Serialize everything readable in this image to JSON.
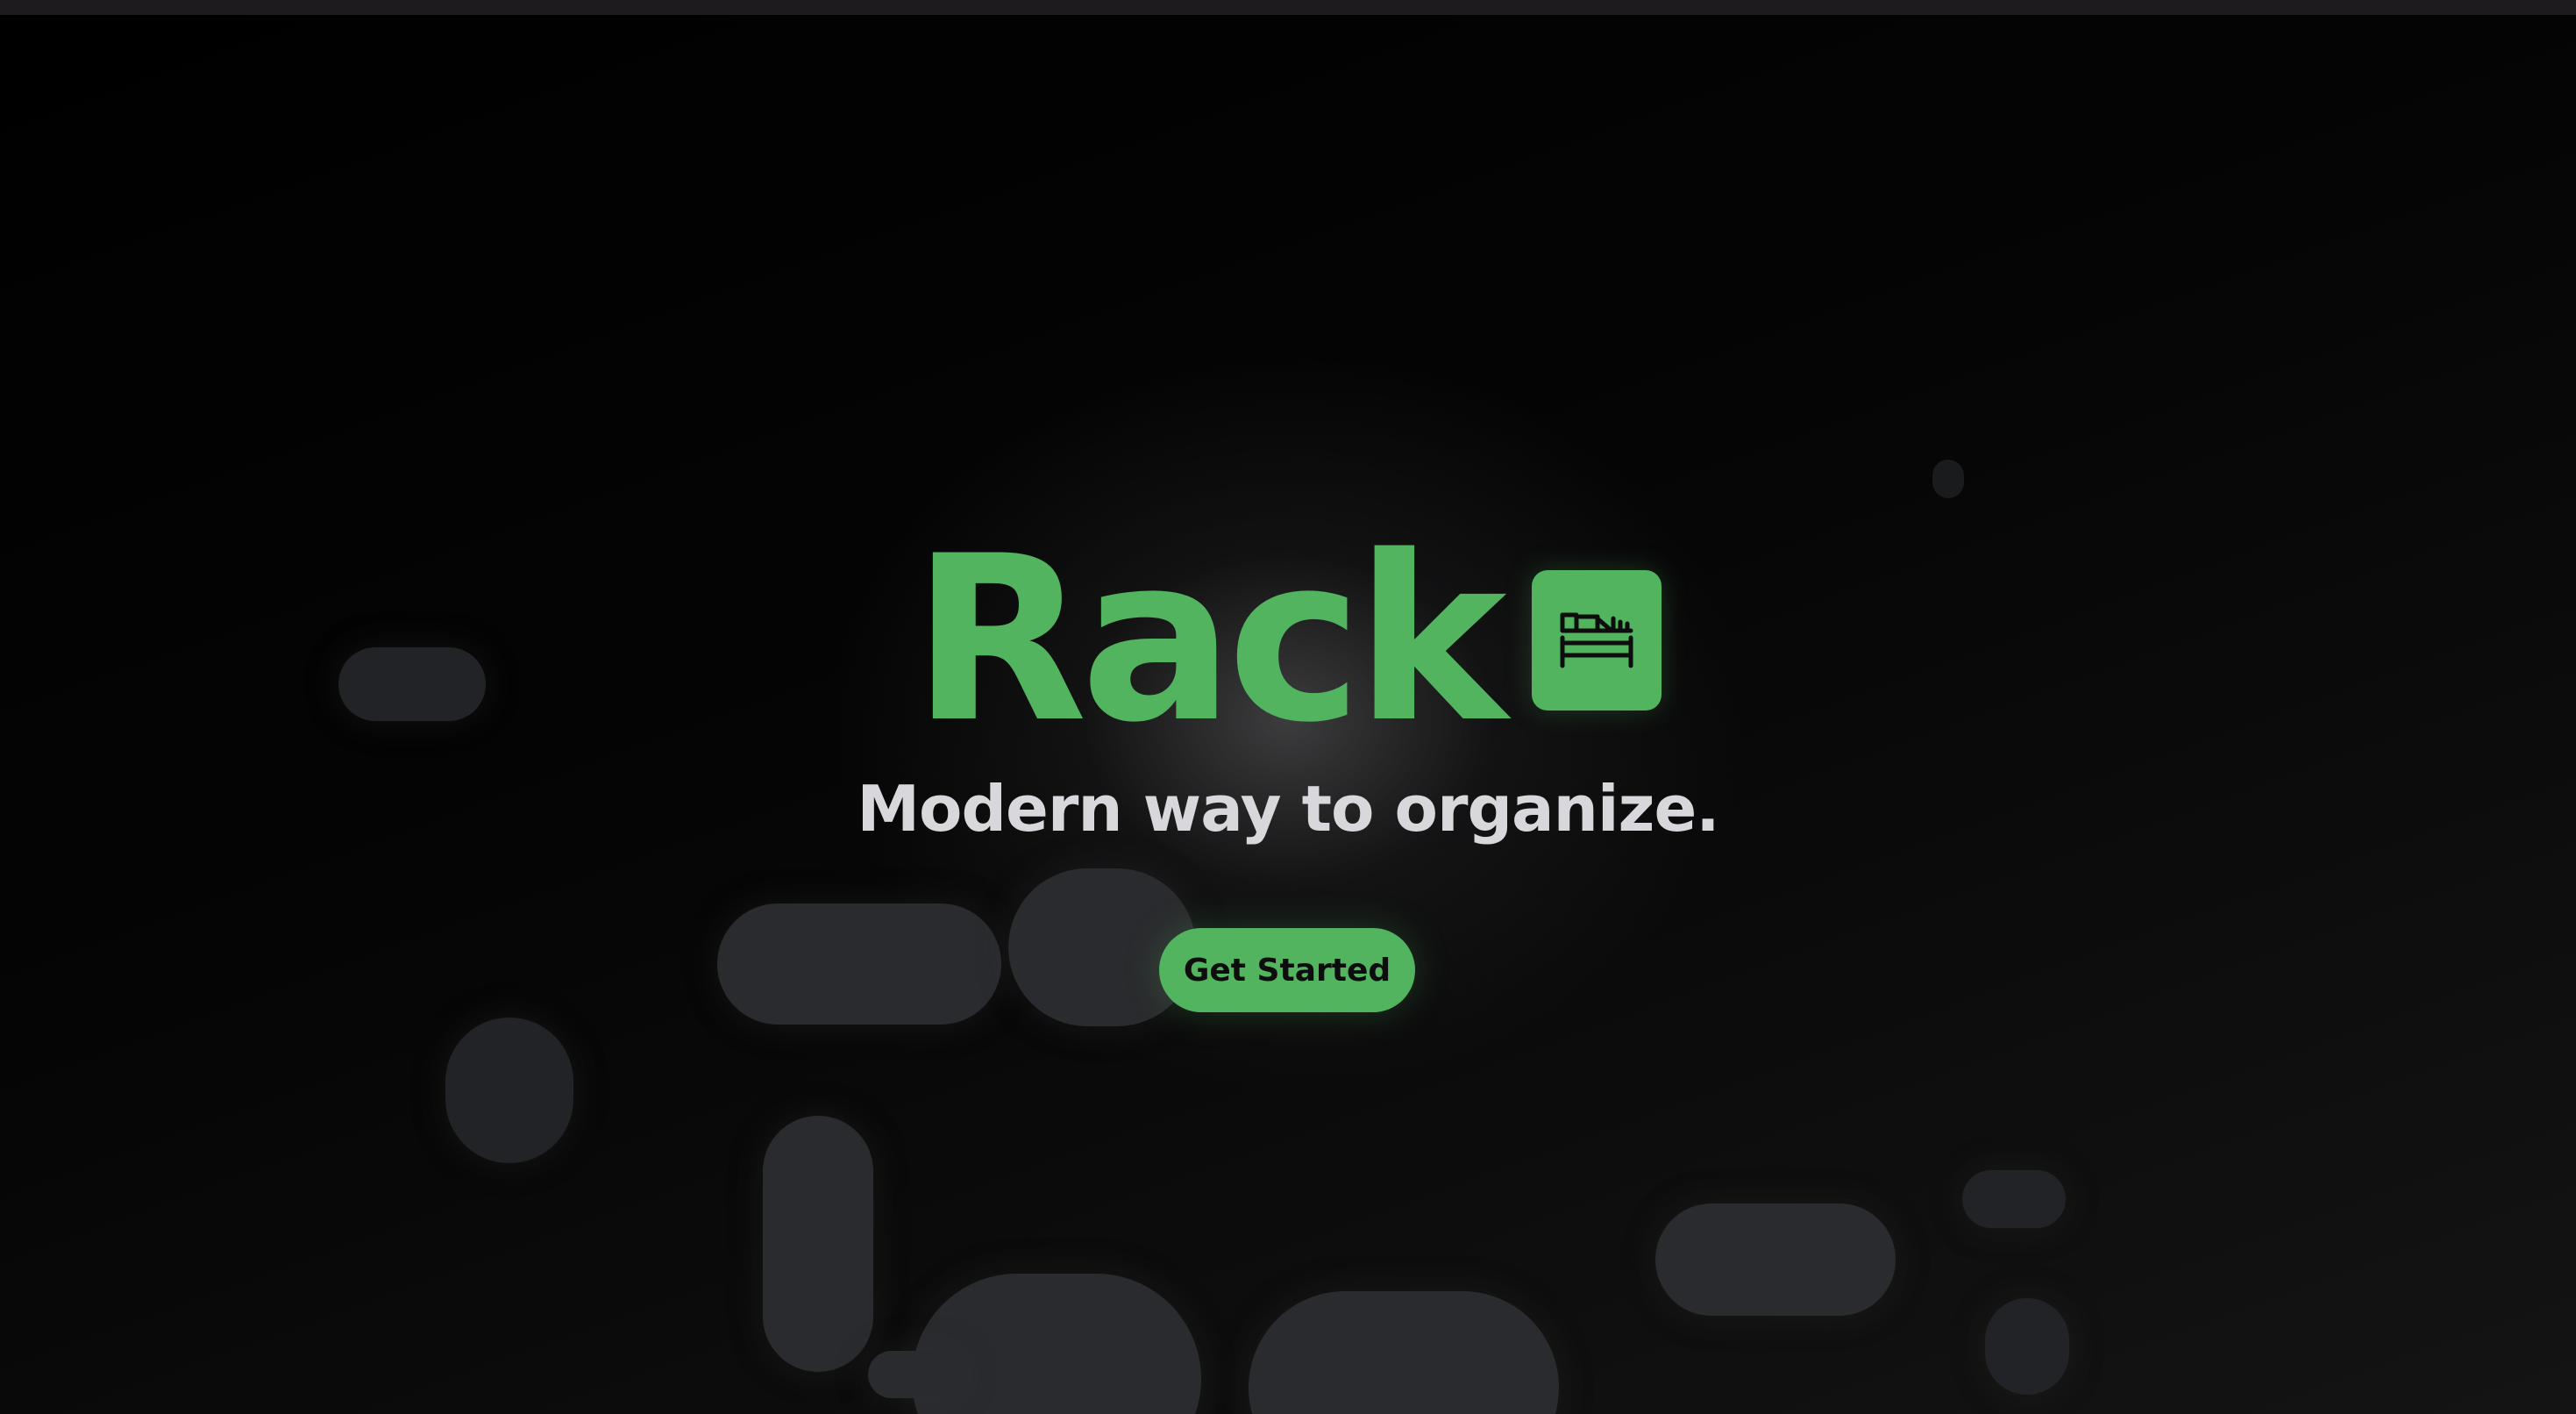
{
  "hero": {
    "title": "Rack",
    "tagline": "Modern way to organize.",
    "cta_label": "Get Started",
    "logo_icon": "shelf-rack-icon"
  },
  "colors": {
    "accent": "#52b45f",
    "background": "#000000",
    "tagline": "#d7d7dc",
    "blob": "#2a2b2e"
  }
}
